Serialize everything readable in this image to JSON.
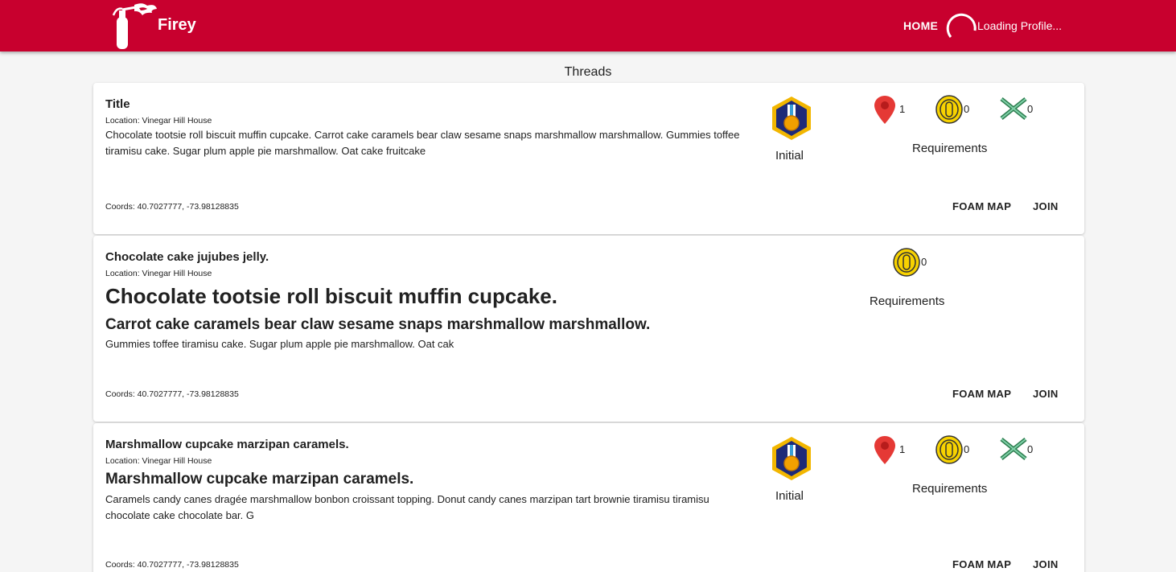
{
  "header": {
    "brand": "Firey",
    "nav_home": "HOME",
    "profile_status": "Loading Profile...",
    "bar_color": "#c8002e",
    "icons": [
      "fire-extinguisher-logo-icon",
      "loading-spinner-icon"
    ]
  },
  "page": {
    "heading": "Threads"
  },
  "threads": [
    {
      "title": "Title",
      "location": "Location: Vinegar Hill House",
      "text": "Chocolate tootsie roll biscuit muffin cupcake. Carrot cake caramels bear claw sesame snaps marshmallow marshmallow. Gummies toffee tiramisu cake. Sugar plum apple pie marshmallow. Oat cake fruitcake",
      "coords": "Coords: 40.7027777, -73.98128835",
      "badge": "Initial",
      "requirements": {
        "label": "Requirements",
        "location": "1",
        "coins": "0",
        "battles": "0"
      },
      "actions": {
        "map": "FOAM MAP",
        "join": "JOIN"
      }
    },
    {
      "title": "Chocolate cake jujubes jelly.",
      "location": "Location: Vinegar Hill House",
      "heading1": "Chocolate tootsie roll biscuit muffin cupcake.",
      "heading2": "Carrot cake caramels bear claw sesame snaps marshmallow marshmallow.",
      "text": "Gummies toffee tiramisu cake. Sugar plum apple pie marshmallow. Oat cak",
      "coords": "Coords: 40.7027777, -73.98128835",
      "requirements": {
        "label": "Requirements",
        "coins": "0"
      },
      "actions": {
        "map": "FOAM MAP",
        "join": "JOIN"
      }
    },
    {
      "title": "Marshmallow cupcake marzipan caramels.",
      "location": "Location: Vinegar Hill House",
      "heading2": "Marshmallow cupcake marzipan caramels.",
      "text": "Caramels candy canes dragée marshmallow bonbon croissant topping. Donut candy canes marzipan tart brownie tiramisu tiramisu chocolate cake chocolate bar. G",
      "coords": "Coords: 40.7027777, -73.98128835",
      "badge": "Initial",
      "requirements": {
        "label": "Requirements",
        "location": "1",
        "coins": "0",
        "battles": "0"
      },
      "actions": {
        "map": "FOAM MAP",
        "join": "JOIN"
      }
    }
  ]
}
